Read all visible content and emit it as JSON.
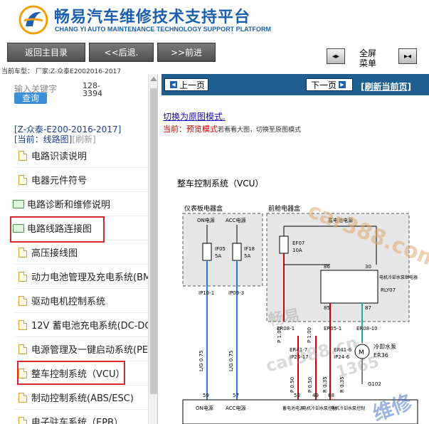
{
  "header": {
    "title": "畅易汽车维修技术支持平台",
    "subtitle": "CHANG YI AUTO MAINTENANCE TECHNOLOGY SUPPORT PLATFORM"
  },
  "toolbar": {
    "home_label": "返回主目录",
    "back_label": "<<后退.",
    "forward_label": ">>前进",
    "fullscreen_line1": "全屏",
    "fullscreen_line2": "菜单"
  },
  "car_type": "当前车型：  厂家:Z-众泰E2002016-2017",
  "left_panel": {
    "search_placeholder": "输入关键字",
    "search_button": "查询",
    "count_line1": "128-",
    "count_line2": "3394",
    "path_line1": "[Z-众泰-E200-2016-2017]",
    "path_current": "[当前：线路图]",
    "path_refresh": "[刷新]",
    "tree": [
      {
        "label": "电路识读说明",
        "type": "doc",
        "child": true
      },
      {
        "label": "电器元件符号",
        "type": "doc",
        "child": true
      },
      {
        "label": "电路诊断和维修说明",
        "type": "folder",
        "child": false
      },
      {
        "label": "电路线路连接图",
        "type": "folder",
        "child": false
      },
      {
        "label": "高压接线图",
        "type": "doc",
        "child": true
      },
      {
        "label": "动力电池管理及充电系统(BM",
        "type": "doc",
        "child": true
      },
      {
        "label": "驱动电机控制系统",
        "type": "doc",
        "child": true
      },
      {
        "label": "12V 蓄电池充电系统(DC-DC)",
        "type": "doc",
        "child": true
      },
      {
        "label": "电源管理及一键启动系统(PE",
        "type": "doc",
        "child": true
      },
      {
        "label": "整车控制系统（VCU）",
        "type": "doc",
        "child": true
      },
      {
        "label": "制动控制系统(ABS/ESC)",
        "type": "doc",
        "child": true
      },
      {
        "label": "电子驻车系统（EPB）",
        "type": "doc",
        "child": true
      }
    ]
  },
  "right_panel": {
    "prev_label": "上一页",
    "next_label": "下一页",
    "refresh_label": "[刷新当前页]",
    "switch_label": "切换为原图模式.",
    "current_label": "当前：",
    "preview_mode": "预览模式",
    "preview_note": "若看看大图，切换至原图模式"
  },
  "diagram": {
    "title": "整车控制系统（VCU）",
    "box1_title": "仪表板电器盒",
    "box2_title": "前舱电器盒",
    "on_power": "ON电源",
    "acc_power": "ACC电源",
    "battery_power": "蓄电池电源",
    "fuse1": "IF05",
    "fuse1_amp": "5A",
    "fuse2": "IF18",
    "fuse2_amp": "5A",
    "fuse3": "EF07",
    "fuse3_amp": "10A",
    "relay_label": "电机冷却水泵继电器",
    "relay_id": "RLY07",
    "pin86": "86",
    "pin30": "30",
    "pin85": "85",
    "pin87": "87",
    "conn1": "IP10-1",
    "conn2": "IP09-3",
    "conn3": "ER08-1",
    "conn4": "ER05-1",
    "conn5": "ER08-10",
    "conn6": "ER41-7",
    "conn7": "IP24-17",
    "conn8": "ER41-6",
    "conn9": "IP24-6",
    "wire1": "L/G 0.75",
    "wire2": "L/G 0.75",
    "wire3": "P 1.00",
    "wire4": "P 1.00",
    "wire5": "P 0.50",
    "wire6": "R 0.35",
    "wire7": "P 0.50",
    "wire8": "R 0.35",
    "pump_label": "冷却水泵",
    "pump_id": "ER36",
    "ground": "G102",
    "pin59": "59",
    "pin57": "57",
    "pin50": "50",
    "pin49": "49",
    "pin68": "68",
    "bottom1": "ON电源",
    "bottom2": "ACC电源",
    "bottom3": "蓄电池电源",
    "bottom4": "电机冷却水泵控制",
    "bottom5": "电机冷却水泵控制",
    "watermark1": "car388.com",
    "watermark2": "畅易",
    "watermark3": "car388.cn",
    "watermark4": "1365",
    "watermark5": "维修"
  },
  "colors": {
    "brand": "#1b5fae",
    "highlight": "#d9272e",
    "navbar": "#1e5f8f"
  }
}
